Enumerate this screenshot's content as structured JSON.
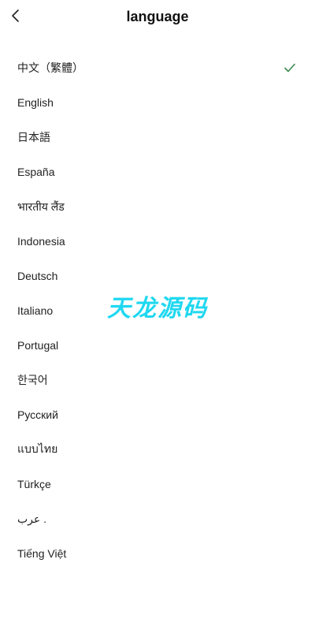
{
  "header": {
    "title": "language",
    "back_icon": "chevron-left-icon"
  },
  "languages": [
    {
      "label": "中文（繁體）",
      "selected": true
    },
    {
      "label": "English",
      "selected": false
    },
    {
      "label": "日本語",
      "selected": false
    },
    {
      "label": "España",
      "selected": false
    },
    {
      "label": "भारतीय लैंड",
      "selected": false
    },
    {
      "label": "Indonesia",
      "selected": false
    },
    {
      "label": "Deutsch",
      "selected": false
    },
    {
      "label": "Italiano",
      "selected": false
    },
    {
      "label": "Portugal",
      "selected": false
    },
    {
      "label": "한국어",
      "selected": false
    },
    {
      "label": "Русский",
      "selected": false
    },
    {
      "label": "แบบไทย",
      "selected": false
    },
    {
      "label": "Türkçe",
      "selected": false
    },
    {
      "label": "عرب .",
      "selected": false
    },
    {
      "label": "Tiếng Việt",
      "selected": false
    }
  ],
  "check_icon": "checkmark-icon",
  "check_color": "#3a8a4f",
  "watermark": "天龙源码",
  "watermark_color": "#1fd8f0"
}
